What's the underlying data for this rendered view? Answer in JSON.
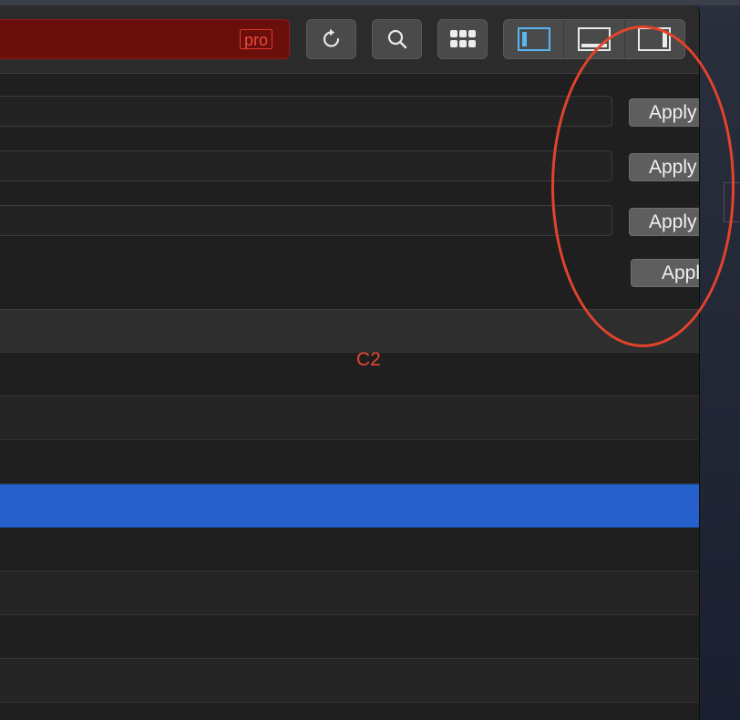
{
  "toolbar": {
    "address_badge": "pro",
    "icons": {
      "reload": "reload-icon",
      "search": "search-icon",
      "grid": "grid-icon",
      "layout_left": "layout-left-panel-icon",
      "layout_bottom": "layout-bottom-panel-icon",
      "layout_right": "layout-right-panel-icon"
    },
    "active_layout": "left"
  },
  "form": {
    "fields": [
      {
        "value": "",
        "apply_label": "Apply"
      },
      {
        "value": "",
        "apply_label": "Apply"
      },
      {
        "value": "",
        "apply_label": "Apply"
      }
    ],
    "extra_apply_label": "Apply"
  },
  "list": {
    "rows": [
      {
        "kind": "header"
      },
      {
        "kind": "plain"
      },
      {
        "kind": "alt"
      },
      {
        "kind": "plain"
      },
      {
        "kind": "selected"
      },
      {
        "kind": "plain"
      },
      {
        "kind": "alt"
      },
      {
        "kind": "plain"
      },
      {
        "kind": "alt"
      },
      {
        "kind": "plain"
      }
    ]
  },
  "annotation": {
    "label": "C2",
    "color": "#e3432c"
  },
  "colors": {
    "address_bar": "#6a0f0c",
    "selection": "#2560cc",
    "active_icon": "#5ab4f0"
  }
}
